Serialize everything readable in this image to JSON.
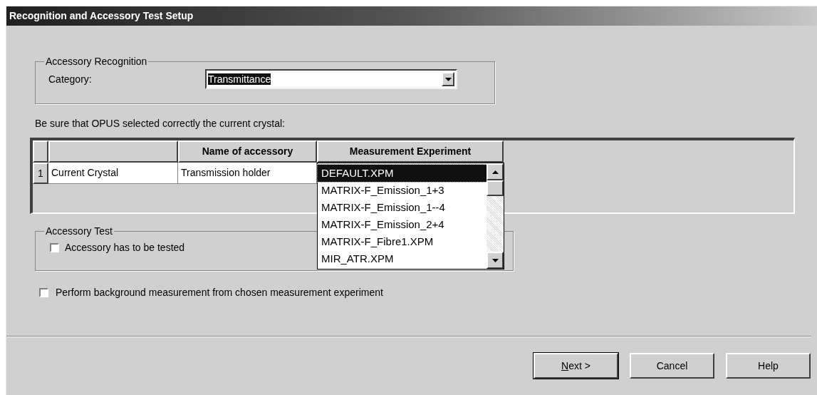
{
  "window": {
    "title": "Recognition and Accessory Test Setup"
  },
  "accessory_recognition": {
    "title": "Accessory Recognition",
    "category_label": "Category:",
    "category_value": "Transmittance",
    "focused": true
  },
  "instruction": "Be sure that OPUS selected correctly the current crystal:",
  "table": {
    "columns": [
      "Name of accessory",
      "Measurement Experiment"
    ],
    "rows": [
      {
        "row_header": "1",
        "label": "Current Crystal",
        "accessory": "Transmission holder"
      }
    ]
  },
  "experiment_list": [
    {
      "label": "DEFAULT.XPM",
      "selected": true
    },
    {
      "label": "MATRIX-F_Emission_1+3",
      "selected": false
    },
    {
      "label": "MATRIX-F_Emission_1--4",
      "selected": false
    },
    {
      "label": "MATRIX-F_Emission_2+4",
      "selected": false
    },
    {
      "label": "MATRIX-F_Fibre1.XPM",
      "selected": false
    },
    {
      "label": "MIR_ATR.XPM",
      "selected": false
    }
  ],
  "accessory_test": {
    "title": "Accessory Test",
    "checkbox": {
      "label": "Accessory has to be tested",
      "checked": false
    }
  },
  "background_checkbox": {
    "label": "Perform background measurement from chosen measurement experiment",
    "checked": false
  },
  "buttons": [
    {
      "label": "Next >",
      "default": true,
      "underline_first": true
    },
    {
      "label": "Cancel",
      "default": false,
      "underline_first": false
    },
    {
      "label": "Help",
      "default": false,
      "underline_first": false
    }
  ]
}
